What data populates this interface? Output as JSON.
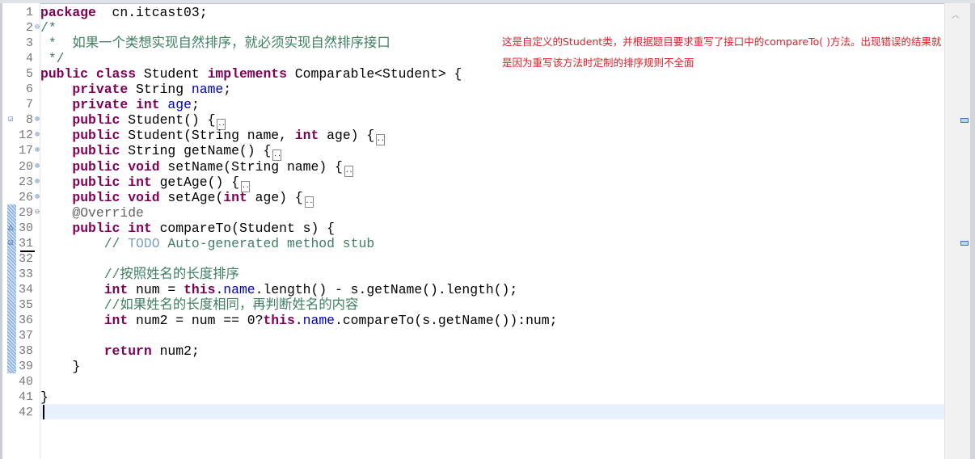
{
  "editor": {
    "lines": [
      {
        "n": "1",
        "segs": [
          [
            "kw",
            "package"
          ],
          [
            "",
            "  cn.itcast03;"
          ]
        ]
      },
      {
        "n": "2",
        "fold": "minus",
        "segs": [
          [
            "cm",
            "/*"
          ]
        ]
      },
      {
        "n": "3",
        "segs": [
          [
            "cm",
            " *  如果一个类想实现自然排序，就必须实现自然排序接口"
          ]
        ]
      },
      {
        "n": "4",
        "segs": [
          [
            "cm",
            " */"
          ]
        ]
      },
      {
        "n": "5",
        "segs": [
          [
            "kw",
            "public"
          ],
          [
            "",
            " "
          ],
          [
            "kw",
            "class"
          ],
          [
            "",
            " Student "
          ],
          [
            "kw",
            "implements"
          ],
          [
            "",
            " Comparable<Student> {"
          ]
        ]
      },
      {
        "n": "6",
        "segs": [
          [
            "",
            "    "
          ],
          [
            "kw",
            "private"
          ],
          [
            "",
            " String "
          ],
          [
            "fd",
            "name"
          ],
          [
            "",
            ";"
          ]
        ]
      },
      {
        "n": "7",
        "segs": [
          [
            "",
            "    "
          ],
          [
            "kw",
            "private"
          ],
          [
            "",
            " "
          ],
          [
            "kw",
            "int"
          ],
          [
            "",
            " "
          ],
          [
            "fd",
            "age"
          ],
          [
            "",
            ";"
          ]
        ]
      },
      {
        "n": "8",
        "fold": "plus",
        "mark": "task",
        "segs": [
          [
            "",
            "    "
          ],
          [
            "kw",
            "public"
          ],
          [
            "",
            " Student() {"
          ]
        ],
        "folded": true
      },
      {
        "n": "12",
        "fold": "plus",
        "segs": [
          [
            "",
            "    "
          ],
          [
            "kw",
            "public"
          ],
          [
            "",
            " Student(String name, "
          ],
          [
            "kw",
            "int"
          ],
          [
            "",
            " age) {"
          ]
        ],
        "folded": true
      },
      {
        "n": "17",
        "fold": "plus",
        "segs": [
          [
            "",
            "    "
          ],
          [
            "kw",
            "public"
          ],
          [
            "",
            " String getName() {"
          ]
        ],
        "folded": true
      },
      {
        "n": "20",
        "fold": "plus",
        "segs": [
          [
            "",
            "    "
          ],
          [
            "kw",
            "public"
          ],
          [
            "",
            " "
          ],
          [
            "kw",
            "void"
          ],
          [
            "",
            " setName(String name) {"
          ]
        ],
        "folded": true
      },
      {
        "n": "23",
        "fold": "plus",
        "segs": [
          [
            "",
            "    "
          ],
          [
            "kw",
            "public"
          ],
          [
            "",
            " "
          ],
          [
            "kw",
            "int"
          ],
          [
            "",
            " getAge() {"
          ]
        ],
        "folded": true
      },
      {
        "n": "26",
        "fold": "plus",
        "segs": [
          [
            "",
            "    "
          ],
          [
            "kw",
            "public"
          ],
          [
            "",
            " "
          ],
          [
            "kw",
            "void"
          ],
          [
            "",
            " setAge("
          ],
          [
            "kw",
            "int"
          ],
          [
            "",
            " age) {"
          ]
        ],
        "folded": true
      },
      {
        "n": "29",
        "fold": "minus",
        "segs": [
          [
            "",
            "    "
          ],
          [
            "an",
            "@Override"
          ]
        ]
      },
      {
        "n": "30",
        "mark": "override",
        "segs": [
          [
            "",
            "    "
          ],
          [
            "kw",
            "public"
          ],
          [
            "",
            " "
          ],
          [
            "kw",
            "int"
          ],
          [
            "",
            " compareTo(Student s) {"
          ]
        ]
      },
      {
        "n": "31",
        "mark": "task",
        "segs": [
          [
            "",
            "        "
          ],
          [
            "cm",
            "// "
          ],
          [
            "todo",
            "TODO"
          ],
          [
            "cm",
            " Auto-generated method stub"
          ]
        ]
      },
      {
        "n": "32",
        "segs": []
      },
      {
        "n": "33",
        "segs": [
          [
            "",
            "        "
          ],
          [
            "cm",
            "//按照姓名的长度排序"
          ]
        ]
      },
      {
        "n": "34",
        "segs": [
          [
            "",
            "        "
          ],
          [
            "kw",
            "int"
          ],
          [
            "",
            " num = "
          ],
          [
            "kw",
            "this"
          ],
          [
            "",
            "."
          ],
          [
            "fd",
            "name"
          ],
          [
            "",
            ".length() - s.getName().length();"
          ]
        ]
      },
      {
        "n": "35",
        "segs": [
          [
            "",
            "        "
          ],
          [
            "cm",
            "//如果姓名的长度相同，再判断姓名的内容"
          ]
        ]
      },
      {
        "n": "36",
        "segs": [
          [
            "",
            "        "
          ],
          [
            "kw",
            "int"
          ],
          [
            "",
            " num2 = num == 0?"
          ],
          [
            "kw",
            "this"
          ],
          [
            "",
            "."
          ],
          [
            "fd",
            "name"
          ],
          [
            "",
            ".compareTo(s.getName()):num;"
          ]
        ]
      },
      {
        "n": "37",
        "segs": []
      },
      {
        "n": "38",
        "segs": [
          [
            "",
            "        "
          ],
          [
            "kw",
            "return"
          ],
          [
            "",
            " num2;"
          ]
        ]
      },
      {
        "n": "39",
        "segs": [
          [
            "",
            "    }"
          ]
        ]
      },
      {
        "n": "40",
        "segs": []
      },
      {
        "n": "41",
        "segs": [
          [
            "",
            "}"
          ]
        ]
      },
      {
        "n": "42",
        "segs": []
      }
    ]
  },
  "annotation": {
    "text": "这是自定义的Student类，并根据题目要求重写了接口中的compareTo( )方法。出现错误的结果就是因为重写该方法时定制的排序规则不全面",
    "color": "#e0202a"
  },
  "colors": {
    "keyword": "#7f0055",
    "comment": "#3f7f5f",
    "field": "#0000c0",
    "current_line": "#e8f2fe"
  }
}
